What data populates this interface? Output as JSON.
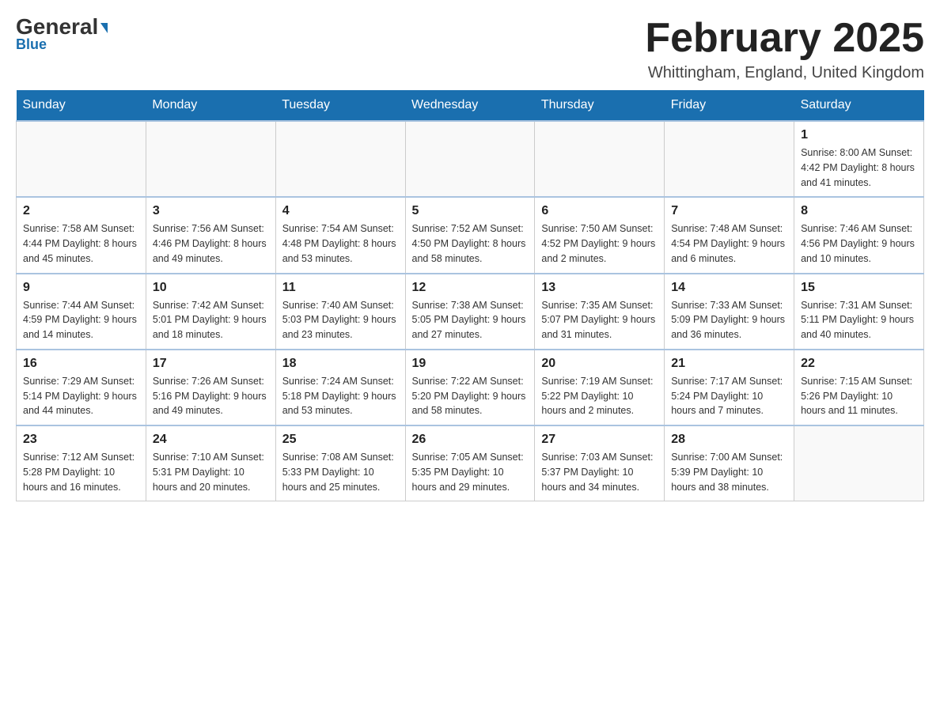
{
  "header": {
    "logo_general": "General",
    "logo_blue": "Blue",
    "month_title": "February 2025",
    "location": "Whittingham, England, United Kingdom"
  },
  "days_of_week": [
    "Sunday",
    "Monday",
    "Tuesday",
    "Wednesday",
    "Thursday",
    "Friday",
    "Saturday"
  ],
  "weeks": [
    [
      {
        "day": "",
        "info": ""
      },
      {
        "day": "",
        "info": ""
      },
      {
        "day": "",
        "info": ""
      },
      {
        "day": "",
        "info": ""
      },
      {
        "day": "",
        "info": ""
      },
      {
        "day": "",
        "info": ""
      },
      {
        "day": "1",
        "info": "Sunrise: 8:00 AM\nSunset: 4:42 PM\nDaylight: 8 hours and 41 minutes."
      }
    ],
    [
      {
        "day": "2",
        "info": "Sunrise: 7:58 AM\nSunset: 4:44 PM\nDaylight: 8 hours and 45 minutes."
      },
      {
        "day": "3",
        "info": "Sunrise: 7:56 AM\nSunset: 4:46 PM\nDaylight: 8 hours and 49 minutes."
      },
      {
        "day": "4",
        "info": "Sunrise: 7:54 AM\nSunset: 4:48 PM\nDaylight: 8 hours and 53 minutes."
      },
      {
        "day": "5",
        "info": "Sunrise: 7:52 AM\nSunset: 4:50 PM\nDaylight: 8 hours and 58 minutes."
      },
      {
        "day": "6",
        "info": "Sunrise: 7:50 AM\nSunset: 4:52 PM\nDaylight: 9 hours and 2 minutes."
      },
      {
        "day": "7",
        "info": "Sunrise: 7:48 AM\nSunset: 4:54 PM\nDaylight: 9 hours and 6 minutes."
      },
      {
        "day": "8",
        "info": "Sunrise: 7:46 AM\nSunset: 4:56 PM\nDaylight: 9 hours and 10 minutes."
      }
    ],
    [
      {
        "day": "9",
        "info": "Sunrise: 7:44 AM\nSunset: 4:59 PM\nDaylight: 9 hours and 14 minutes."
      },
      {
        "day": "10",
        "info": "Sunrise: 7:42 AM\nSunset: 5:01 PM\nDaylight: 9 hours and 18 minutes."
      },
      {
        "day": "11",
        "info": "Sunrise: 7:40 AM\nSunset: 5:03 PM\nDaylight: 9 hours and 23 minutes."
      },
      {
        "day": "12",
        "info": "Sunrise: 7:38 AM\nSunset: 5:05 PM\nDaylight: 9 hours and 27 minutes."
      },
      {
        "day": "13",
        "info": "Sunrise: 7:35 AM\nSunset: 5:07 PM\nDaylight: 9 hours and 31 minutes."
      },
      {
        "day": "14",
        "info": "Sunrise: 7:33 AM\nSunset: 5:09 PM\nDaylight: 9 hours and 36 minutes."
      },
      {
        "day": "15",
        "info": "Sunrise: 7:31 AM\nSunset: 5:11 PM\nDaylight: 9 hours and 40 minutes."
      }
    ],
    [
      {
        "day": "16",
        "info": "Sunrise: 7:29 AM\nSunset: 5:14 PM\nDaylight: 9 hours and 44 minutes."
      },
      {
        "day": "17",
        "info": "Sunrise: 7:26 AM\nSunset: 5:16 PM\nDaylight: 9 hours and 49 minutes."
      },
      {
        "day": "18",
        "info": "Sunrise: 7:24 AM\nSunset: 5:18 PM\nDaylight: 9 hours and 53 minutes."
      },
      {
        "day": "19",
        "info": "Sunrise: 7:22 AM\nSunset: 5:20 PM\nDaylight: 9 hours and 58 minutes."
      },
      {
        "day": "20",
        "info": "Sunrise: 7:19 AM\nSunset: 5:22 PM\nDaylight: 10 hours and 2 minutes."
      },
      {
        "day": "21",
        "info": "Sunrise: 7:17 AM\nSunset: 5:24 PM\nDaylight: 10 hours and 7 minutes."
      },
      {
        "day": "22",
        "info": "Sunrise: 7:15 AM\nSunset: 5:26 PM\nDaylight: 10 hours and 11 minutes."
      }
    ],
    [
      {
        "day": "23",
        "info": "Sunrise: 7:12 AM\nSunset: 5:28 PM\nDaylight: 10 hours and 16 minutes."
      },
      {
        "day": "24",
        "info": "Sunrise: 7:10 AM\nSunset: 5:31 PM\nDaylight: 10 hours and 20 minutes."
      },
      {
        "day": "25",
        "info": "Sunrise: 7:08 AM\nSunset: 5:33 PM\nDaylight: 10 hours and 25 minutes."
      },
      {
        "day": "26",
        "info": "Sunrise: 7:05 AM\nSunset: 5:35 PM\nDaylight: 10 hours and 29 minutes."
      },
      {
        "day": "27",
        "info": "Sunrise: 7:03 AM\nSunset: 5:37 PM\nDaylight: 10 hours and 34 minutes."
      },
      {
        "day": "28",
        "info": "Sunrise: 7:00 AM\nSunset: 5:39 PM\nDaylight: 10 hours and 38 minutes."
      },
      {
        "day": "",
        "info": ""
      }
    ]
  ]
}
